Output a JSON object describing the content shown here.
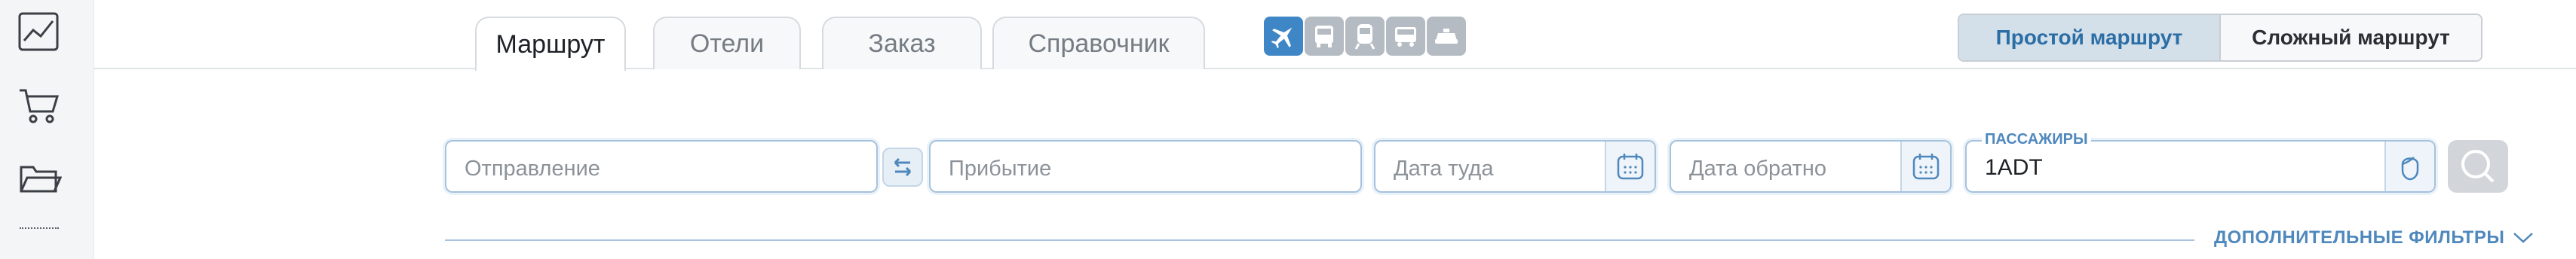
{
  "tabs": [
    "Маршрут",
    "Отели",
    "Заказ",
    "Справочник"
  ],
  "active_tab": "Маршрут",
  "transport_modes": [
    "airplane-icon",
    "bus-icon",
    "train-icon",
    "bus-alt-icon",
    "car-icon"
  ],
  "route_type": {
    "simple": "Простой маршрут",
    "complex": "Сложный маршрут",
    "selected": "simple"
  },
  "search": {
    "from_placeholder": "Отправление",
    "to_placeholder": "Прибытие",
    "date_out_placeholder": "Дата туда",
    "date_back_placeholder": "Дата обратно",
    "passengers_label": "ПАССАЖИРЫ",
    "passengers_value": "1ADT"
  },
  "filters_label": "ДОПОЛНИТЕЛЬНЫЕ ФИЛЬТРЫ",
  "sidebar": [
    "chart-icon",
    "cart-icon",
    "folder-icon"
  ],
  "colors": {
    "accent": "#3f86c6",
    "field_border": "#a6c2dc",
    "label_blue": "#4f88bd"
  }
}
